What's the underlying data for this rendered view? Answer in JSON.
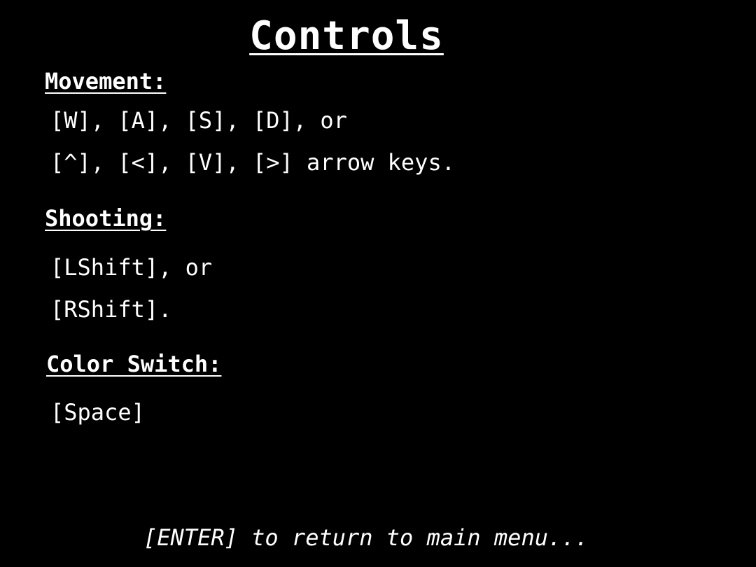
{
  "title": "Controls",
  "sections": [
    {
      "heading": "Movement:",
      "lines": [
        "[W], [A], [S], [D], or",
        "[^], [<], [V], [>] arrow keys."
      ]
    },
    {
      "heading": "Shooting:",
      "lines": [
        "[LShift], or",
        "[RShift]."
      ]
    },
    {
      "heading": "Color Switch:",
      "lines": [
        "[Space]"
      ]
    }
  ],
  "footer": "[ENTER] to return to main menu...",
  "colors": {
    "background": "#000000",
    "text": "#ffffff"
  }
}
